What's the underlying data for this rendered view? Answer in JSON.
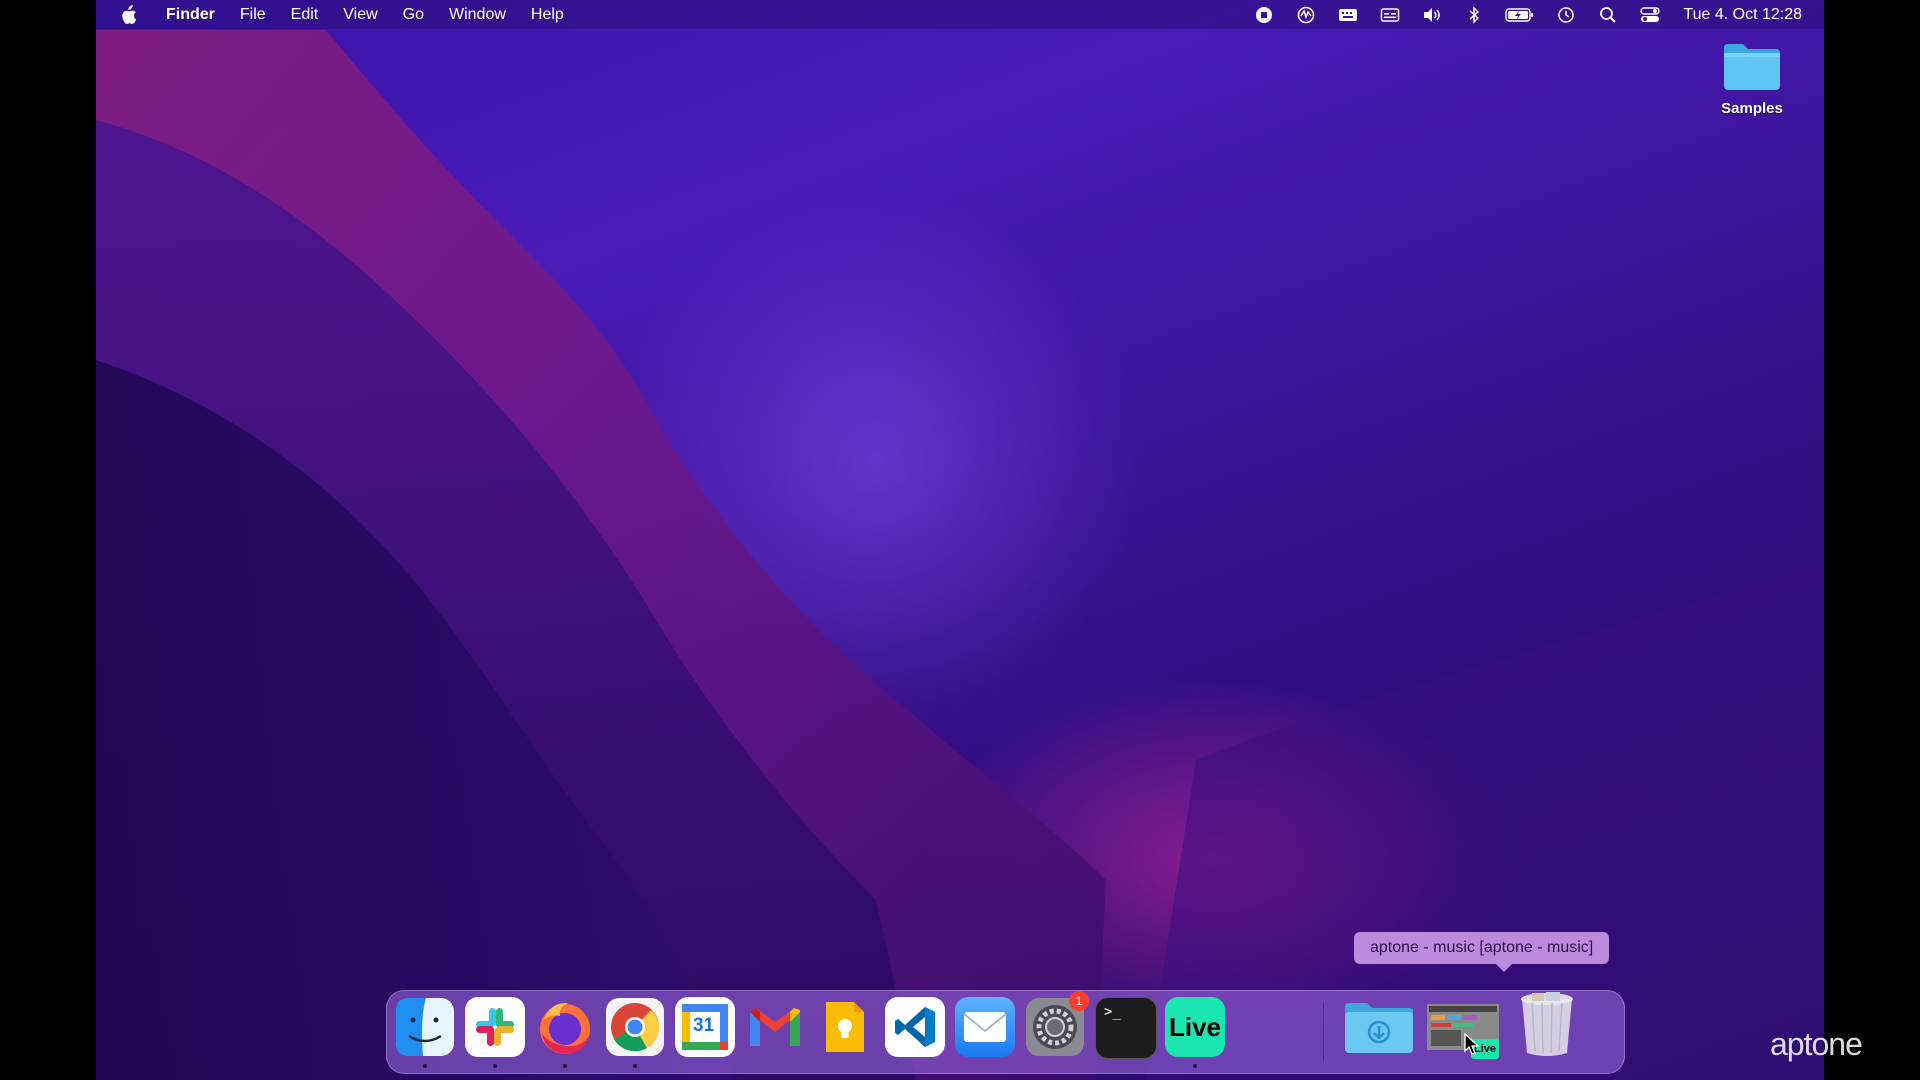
{
  "menubar": {
    "apple_icon": "apple-logo-icon",
    "app_name": "Finder",
    "menus": [
      "File",
      "Edit",
      "View",
      "Go",
      "Window",
      "Help"
    ],
    "status_icons": [
      "screen-record-icon",
      "activity-icon",
      "keyboard-icon",
      "captions-icon",
      "volume-icon",
      "bluetooth-icon",
      "battery-icon",
      "time-machine-icon",
      "spotlight-icon",
      "control-center-icon"
    ],
    "clock": "Tue 4. Oct  12:28"
  },
  "desktop": {
    "folder_label": "Samples"
  },
  "tooltip": {
    "text": "aptone - music  [aptone - music]"
  },
  "dock": {
    "apps": [
      {
        "name": "Finder",
        "icon": "finder-icon",
        "running": true
      },
      {
        "name": "Slack",
        "icon": "slack-icon",
        "running": true
      },
      {
        "name": "Firefox",
        "icon": "firefox-icon",
        "running": true
      },
      {
        "name": "Chrome",
        "icon": "chrome-icon",
        "running": true
      },
      {
        "name": "Calendar",
        "icon": "calendar-icon",
        "running": false,
        "label": "31"
      },
      {
        "name": "Gmail",
        "icon": "gmail-icon",
        "running": false
      },
      {
        "name": "Keep",
        "icon": "keep-icon",
        "running": false
      },
      {
        "name": "VS Code",
        "icon": "vscode-icon",
        "running": false
      },
      {
        "name": "Mail",
        "icon": "mail-icon",
        "running": false
      },
      {
        "name": "System Preferences",
        "icon": "system-preferences-icon",
        "running": false,
        "badge": "1"
      },
      {
        "name": "Terminal",
        "icon": "terminal-icon",
        "running": false,
        "label": ">_"
      },
      {
        "name": "Ableton Live",
        "icon": "ableton-live-icon",
        "running": true,
        "label": "Live"
      }
    ],
    "stacks": [
      {
        "name": "Downloads",
        "icon": "downloads-folder-icon"
      },
      {
        "name": "aptone - music",
        "icon": "live-project-icon",
        "label": "Live"
      },
      {
        "name": "Trash",
        "icon": "trash-icon"
      }
    ]
  },
  "watermark": "aptone"
}
